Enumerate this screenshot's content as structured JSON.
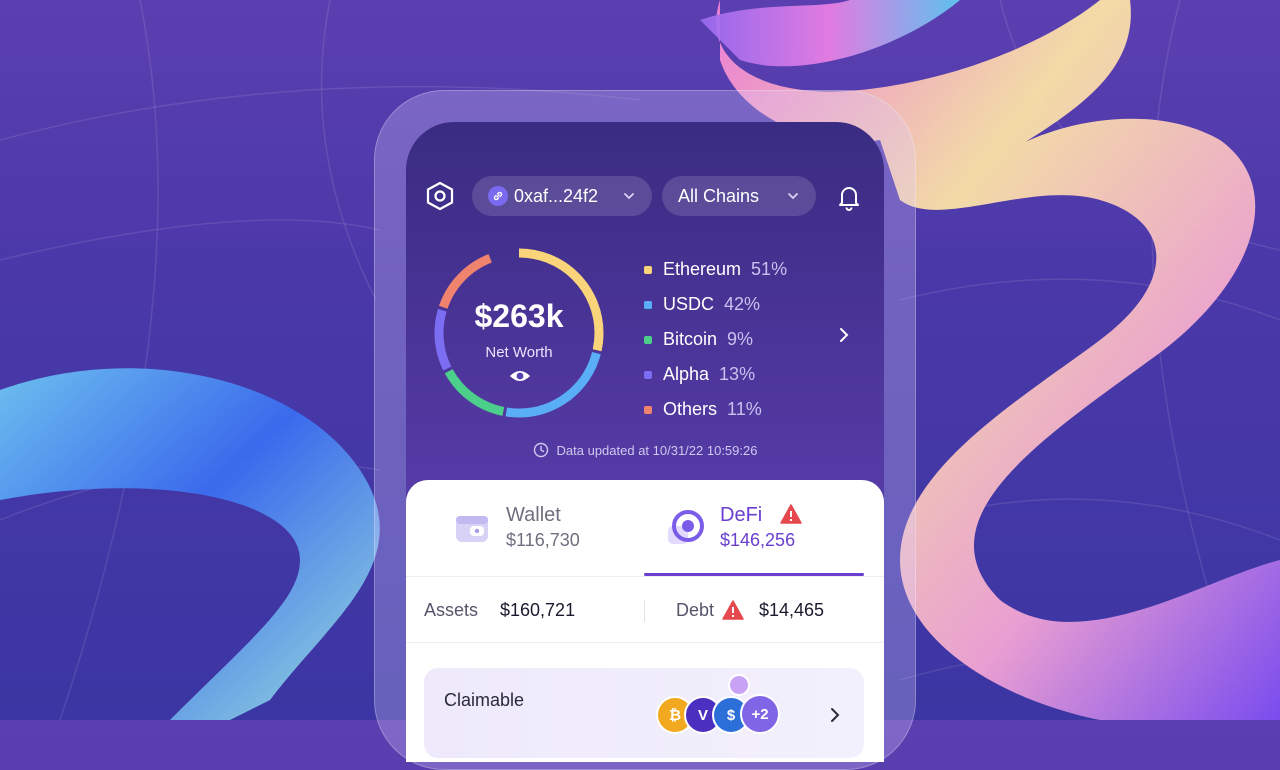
{
  "header": {
    "address": "0xaf...24f2",
    "chain_filter": "All Chains"
  },
  "summary": {
    "net_worth_value": "$263k",
    "net_worth_label": "Net Worth",
    "updated_text": "Data updated at 10/31/22 10:59:26"
  },
  "allocation": [
    {
      "name": "Ethereum",
      "pct": "51%",
      "color": "#f9d47a"
    },
    {
      "name": "USDC",
      "pct": "42%",
      "color": "#5aaef5"
    },
    {
      "name": "Bitcoin",
      "pct": "9%",
      "color": "#4ccf8a"
    },
    {
      "name": "Alpha",
      "pct": "13%",
      "color": "#7b6ef2"
    },
    {
      "name": "Others",
      "pct": "11%",
      "color": "#f0836e"
    }
  ],
  "tabs": {
    "wallet": {
      "label": "Wallet",
      "value": "$116,730"
    },
    "defi": {
      "label": "DeFi",
      "value": "$146,256"
    }
  },
  "balances": {
    "assets_label": "Assets",
    "assets_value": "$160,721",
    "debt_label": "Debt",
    "debt_value": "$14,465"
  },
  "claimable": {
    "label": "Claimable",
    "more_count": "+2"
  },
  "colors": {
    "accent": "#6a3fd0",
    "warning": "#e5484d"
  }
}
